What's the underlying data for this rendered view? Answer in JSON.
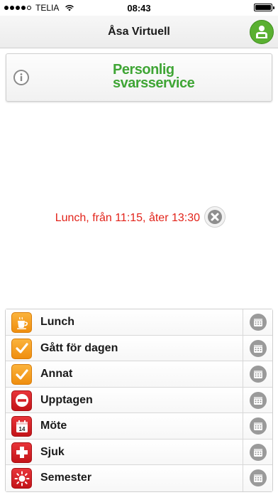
{
  "status_bar": {
    "carrier": "TELIA",
    "time": "08:43",
    "icons": [
      "signal-dots-icon",
      "wifi-icon",
      "battery-icon"
    ]
  },
  "nav": {
    "title": "Åsa Virtuell",
    "profile_icon": "person-icon"
  },
  "info_card": {
    "info_icon": "info-icon",
    "logo_line1": "Personlig",
    "logo_line2": "svarsservice",
    "logo_color": "#3fa535"
  },
  "current_status": {
    "text": "Lunch, från 11:15, åter 13:30",
    "color": "#e2231a",
    "clear_icon": "close-icon"
  },
  "statuses": [
    {
      "label": "Lunch",
      "icon": "coffee-cup-icon",
      "icon_color": "#f5a623"
    },
    {
      "label": "Gått för dagen",
      "icon": "checkmark-icon",
      "icon_color": "#f5a623"
    },
    {
      "label": "Annat",
      "icon": "checkmark-icon",
      "icon_color": "#f5a623"
    },
    {
      "label": "Upptagen",
      "icon": "no-entry-icon",
      "icon_color": "#d42026"
    },
    {
      "label": "Möte",
      "icon": "calendar-icon",
      "icon_color": "#d42026",
      "calendar_day": "14"
    },
    {
      "label": "Sjuk",
      "icon": "cross-icon",
      "icon_color": "#d42026"
    },
    {
      "label": "Semester",
      "icon": "sun-icon",
      "icon_color": "#d42026"
    }
  ]
}
